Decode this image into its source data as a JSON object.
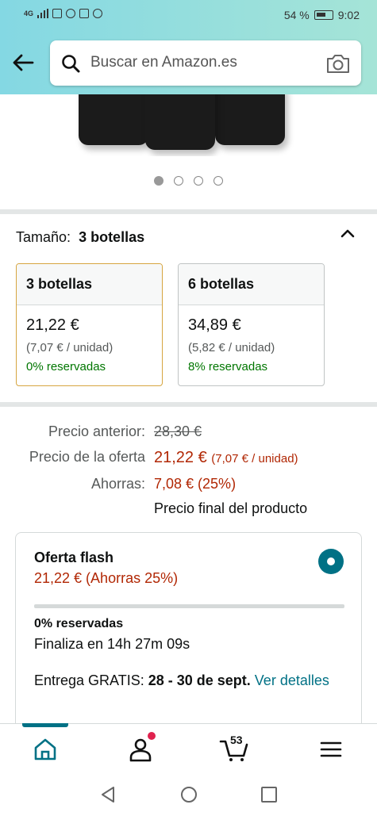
{
  "status_bar": {
    "network": "4G",
    "battery_percent": "54 %",
    "time": "9:02"
  },
  "search": {
    "placeholder": "Buscar en Amazon.es",
    "icon": "search-icon",
    "camera_icon": "camera-icon"
  },
  "gallery": {
    "dot_count": 4,
    "active_index": 0
  },
  "size": {
    "label": "Tamaño:",
    "selected": "3 botellas",
    "options": [
      {
        "name": "3 botellas",
        "price": "21,22 €",
        "unit_price": "(7,07 € / unidad)",
        "reserved": "0% reservadas",
        "selected": true
      },
      {
        "name": "6 botellas",
        "price": "34,89 €",
        "unit_price": "(5,82 € / unidad)",
        "reserved": "8% reservadas",
        "selected": false
      }
    ]
  },
  "price": {
    "previous_label": "Precio anterior:",
    "previous_value": "28,30 €",
    "offer_label": "Precio de la oferta",
    "offer_value": "21,22 €",
    "offer_unit": "(7,07 € / unidad)",
    "savings_label": "Ahorras:",
    "savings_value": "7,08 € (25%)",
    "final_note": "Precio final del producto"
  },
  "flash": {
    "title": "Oferta flash",
    "price": "21,22 € (Ahorras 25%)",
    "reserved": "0% reservadas",
    "reserved_fraction": 0.0,
    "ends": "Finaliza en 14h 27m 09s",
    "delivery_prefix": "Entrega GRATIS: ",
    "delivery_dates": "28 - 30 de sept.",
    "details_link": "Ver detalles"
  },
  "bottom_nav": {
    "cart_count": "53",
    "items": [
      "home-icon",
      "account-icon",
      "cart-icon",
      "menu-icon"
    ]
  },
  "colors": {
    "accent": "#007185",
    "price_red": "#b12704",
    "reserved_green": "#007600",
    "selected_border": "#d6a540"
  }
}
